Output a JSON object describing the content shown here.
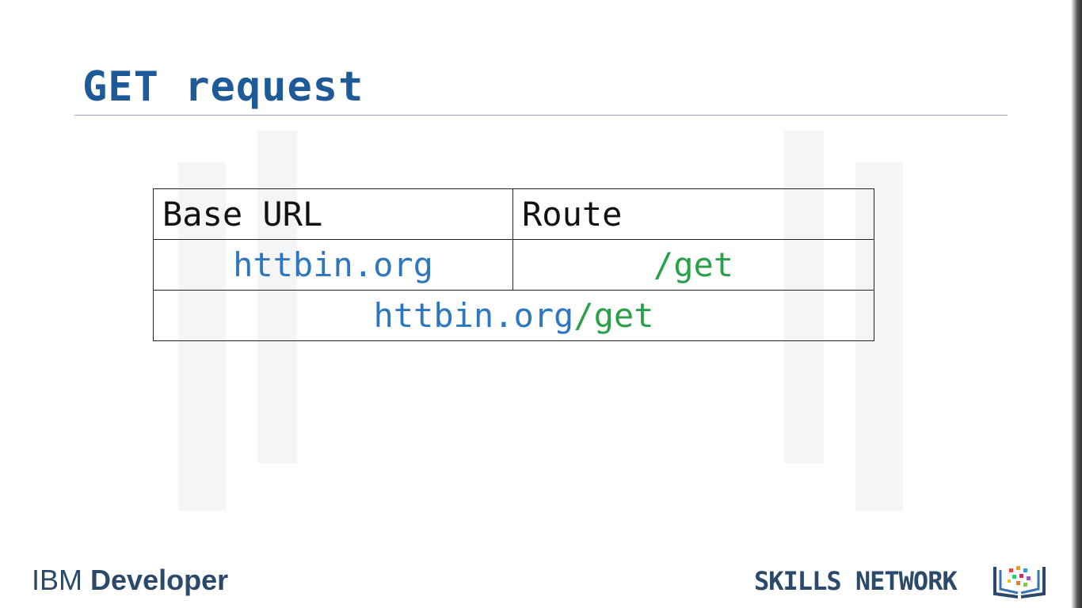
{
  "slide": {
    "title": "GET request",
    "table": {
      "headers": [
        "Base URL",
        "Route"
      ],
      "row": {
        "base": "httbin.org",
        "route": "/get"
      },
      "combined": {
        "base": "httbin.org",
        "route": "/get"
      }
    },
    "colors": {
      "title": "#1f5a98",
      "base": "#2f76c0",
      "route": "#2ba04a"
    }
  },
  "footer": {
    "ibm_prefix": "IBM",
    "ibm_brand": "Developer",
    "skills_network": "SKILLS NETWORK",
    "logo_icon": "book-network-icon"
  }
}
